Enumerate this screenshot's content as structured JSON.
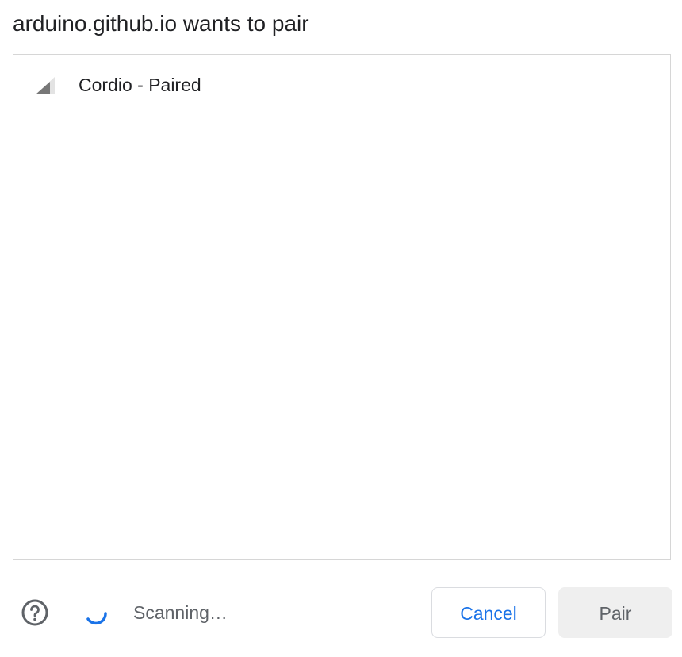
{
  "dialog": {
    "title": "arduino.github.io wants to pair"
  },
  "device_list": {
    "items": [
      {
        "label": "Cordio - Paired",
        "icon": "signal-strength-icon"
      }
    ]
  },
  "footer": {
    "help_icon": "help-circle-icon",
    "spinner_icon": "loading-spinner-icon",
    "status": "Scanning…",
    "cancel_label": "Cancel",
    "pair_label": "Pair"
  },
  "colors": {
    "accent": "#1a73e8",
    "title_text": "#202124",
    "secondary_text": "#5f6368",
    "border": "#d6d6d6",
    "disabled_button_bg": "#efefef"
  }
}
